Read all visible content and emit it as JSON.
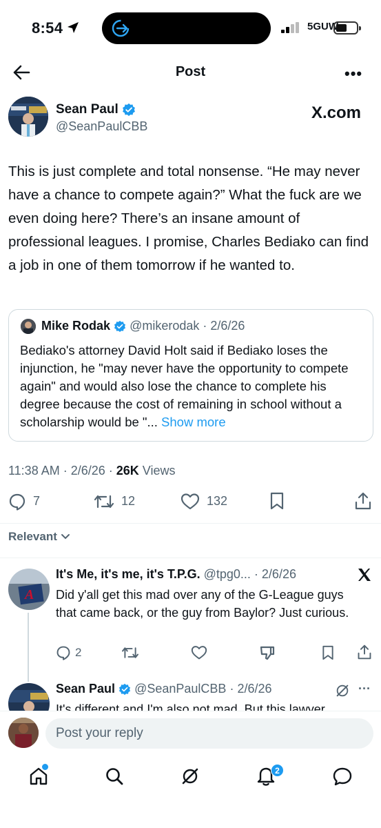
{
  "status_bar": {
    "time": "8:54",
    "network": "5GUW"
  },
  "nav": {
    "title": "Post"
  },
  "post": {
    "author_name": "Sean Paul",
    "author_handle": "@SeanPaulCBB",
    "source": "X.com",
    "text": "This is just complete and total nonsense. “He may never have a chance to compete again?” What the fuck are we even doing here? There’s an insane amount of professional leagues. I promise, Charles Bediako can find a job in one of them tomorrow if he wanted to.",
    "quote": {
      "name": "Mike Rodak",
      "handle": "@mikerodak",
      "date": "· 2/6/26",
      "text": "Bediako's attorney David Holt said if Bediako loses the injunction, he \"may never have the opportunity to compete again\" and would also lose the chance to complete his degree because the cost of remaining in school without a scholarship would be \"...",
      "show_more": "Show more"
    },
    "time": "11:38 AM · 2/6/26 · ",
    "views_count": "26K",
    "views_label": " Views",
    "replies": "7",
    "reposts": "12",
    "likes": "132"
  },
  "sort_label": "Relevant",
  "replies": [
    {
      "name": "It's Me, it's me, it's T.P.G.",
      "handle": "@tpg0...",
      "date": "· 2/6/26",
      "text": "Did y'all get this mad over any of the G-League guys that came back, or the guy from Baylor? Just curious.",
      "reply_count": "2"
    },
    {
      "name": "Sean Paul",
      "handle": "@SeanPaulCBB",
      "date": "· 2/6/26",
      "text": "It's different and I'm also not mad. But this lawyer"
    }
  ],
  "composer": {
    "placeholder": "Post your reply"
  },
  "tabbar": {
    "notifications_badge": "2"
  },
  "colors": {
    "accent": "#1d9bf0",
    "muted": "#536471",
    "text": "#0f1419"
  }
}
